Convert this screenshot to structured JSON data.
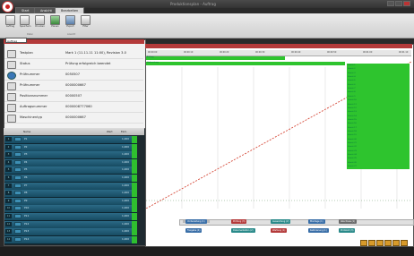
{
  "window": {
    "title": "Produktionsplan - Auftrag",
    "minimize": "_",
    "maximize": "□",
    "close": "×"
  },
  "tabs": [
    {
      "label": "Start"
    },
    {
      "label": "Ansicht"
    },
    {
      "label": "Bearbeiten"
    }
  ],
  "ribbon": {
    "buttons": [
      {
        "label": "Auftrag",
        "icon": "order-icon"
      },
      {
        "label": "Speichern",
        "icon": "save-icon"
      },
      {
        "label": "Drucken",
        "icon": "print-icon"
      },
      {
        "label": "Planen",
        "icon": "plan-icon"
      },
      {
        "label": "Export",
        "icon": "export-icon"
      },
      {
        "label": "Filter",
        "icon": "filter-icon"
      }
    ],
    "groups": [
      "Datei",
      "Ansicht"
    ]
  },
  "left_panel": {
    "dropdown": "Auftrag",
    "rows": [
      {
        "label": "Testplan",
        "value": "Mark 1 (11.11.11 11:00), Revision 3.0",
        "icon": "plan-icon"
      },
      {
        "label": "Status",
        "value": "Prüfung erfolgreich beendet",
        "icon": "status-icon"
      },
      {
        "label": "Prüfnummer",
        "value": "0050507",
        "icon": "globe-icon"
      },
      {
        "label": "Prüfnummer",
        "value": "0000000667",
        "icon": "doc-icon"
      },
      {
        "label": "Positionsnummer",
        "value": "00000507",
        "icon": "doc-icon"
      },
      {
        "label": "Auftragsnummer",
        "value": "0000008777060",
        "icon": "doc-icon"
      },
      {
        "label": "Maschinentyp",
        "value": "0000000667",
        "icon": "doc-icon"
      }
    ]
  },
  "list": {
    "header": {
      "name": "Name",
      "value": "Wert",
      "unit": "Einh."
    },
    "rows": [
      {
        "num": "1",
        "name": "P1",
        "value": "1,000",
        "unit": "mm"
      },
      {
        "num": "2",
        "name": "P2",
        "value": "1,000",
        "unit": "mm"
      },
      {
        "num": "3",
        "name": "P3",
        "value": "1,000",
        "unit": "mm"
      },
      {
        "num": "4",
        "name": "P4",
        "value": "1,000",
        "unit": "mm"
      },
      {
        "num": "5",
        "name": "P5",
        "value": "1,000",
        "unit": "mm"
      },
      {
        "num": "6",
        "name": "P6",
        "value": "1,000",
        "unit": "mm"
      },
      {
        "num": "7",
        "name": "P7",
        "value": "1,000",
        "unit": "mm"
      },
      {
        "num": "8",
        "name": "P8",
        "value": "1,000",
        "unit": "mm"
      },
      {
        "num": "9",
        "name": "P9",
        "value": "1,000",
        "unit": "mm"
      },
      {
        "num": "10",
        "name": "P10",
        "value": "1,000",
        "unit": "mm"
      },
      {
        "num": "11",
        "name": "P11",
        "value": "1,000",
        "unit": "mm"
      },
      {
        "num": "12",
        "name": "P12",
        "value": "1,000",
        "unit": "mm"
      },
      {
        "num": "13",
        "name": "P13",
        "value": "1,000",
        "unit": "mm"
      },
      {
        "num": "14",
        "name": "P14",
        "value": "1,000",
        "unit": "mm"
      }
    ]
  },
  "timeline": {
    "ticks": [
      "00:00:00",
      "00:00:10",
      "00:00:20",
      "00:00:30",
      "00:00:40",
      "00:00:50",
      "00:01:00",
      "00:01:10"
    ],
    "bars_left": [
      "Auftrag",
      "Vorbereitung"
    ],
    "bars_right": [
      "Schritt 1",
      "Schritt 2",
      "Schritt 3",
      "Schritt 4",
      "Schritt 5",
      "Schritt 6",
      "Schritt 7",
      "Schritt 8",
      "Schritt 9",
      "Schritt 10",
      "Schritt 11",
      "Schritt 12",
      "Schritt 13",
      "Schritt 14",
      "Schritt 15",
      "Schritt 16",
      "Schritt 17",
      "Schritt 18",
      "Schritt 19",
      "Schritt 20",
      "Schritt 21",
      "Schritt 22",
      "Schritt 23",
      "Schritt 24",
      "Schritt 25",
      "Schritt 26",
      "Schritt 27"
    ]
  },
  "legend": [
    {
      "label": "Vorbereitung (1)",
      "color": "#3a6fa8"
    },
    {
      "label": "Prüfung (3)",
      "color": "#b43a3a"
    },
    {
      "label": "Auswertung (2)",
      "color": "#2a8a8a"
    },
    {
      "label": "Montage (1)",
      "color": "#3a6fa8"
    },
    {
      "label": "Abschluss (1)",
      "color": "#6a6a6a"
    },
    {
      "label": "Freigabe (4)",
      "color": "#3a6fa8"
    },
    {
      "label": "Dokumentation (2)",
      "color": "#2a8a8a"
    },
    {
      "label": "Wartung (1)",
      "color": "#b43a3a"
    },
    {
      "label": "Kalibrierung (1)",
      "color": "#3a6fa8"
    },
    {
      "label": "Protokoll (3)",
      "color": "#2a8a8a"
    }
  ],
  "colors": {
    "accent": "#b43a3a",
    "bar": "#2ec42e",
    "row": "#2b6a86"
  }
}
